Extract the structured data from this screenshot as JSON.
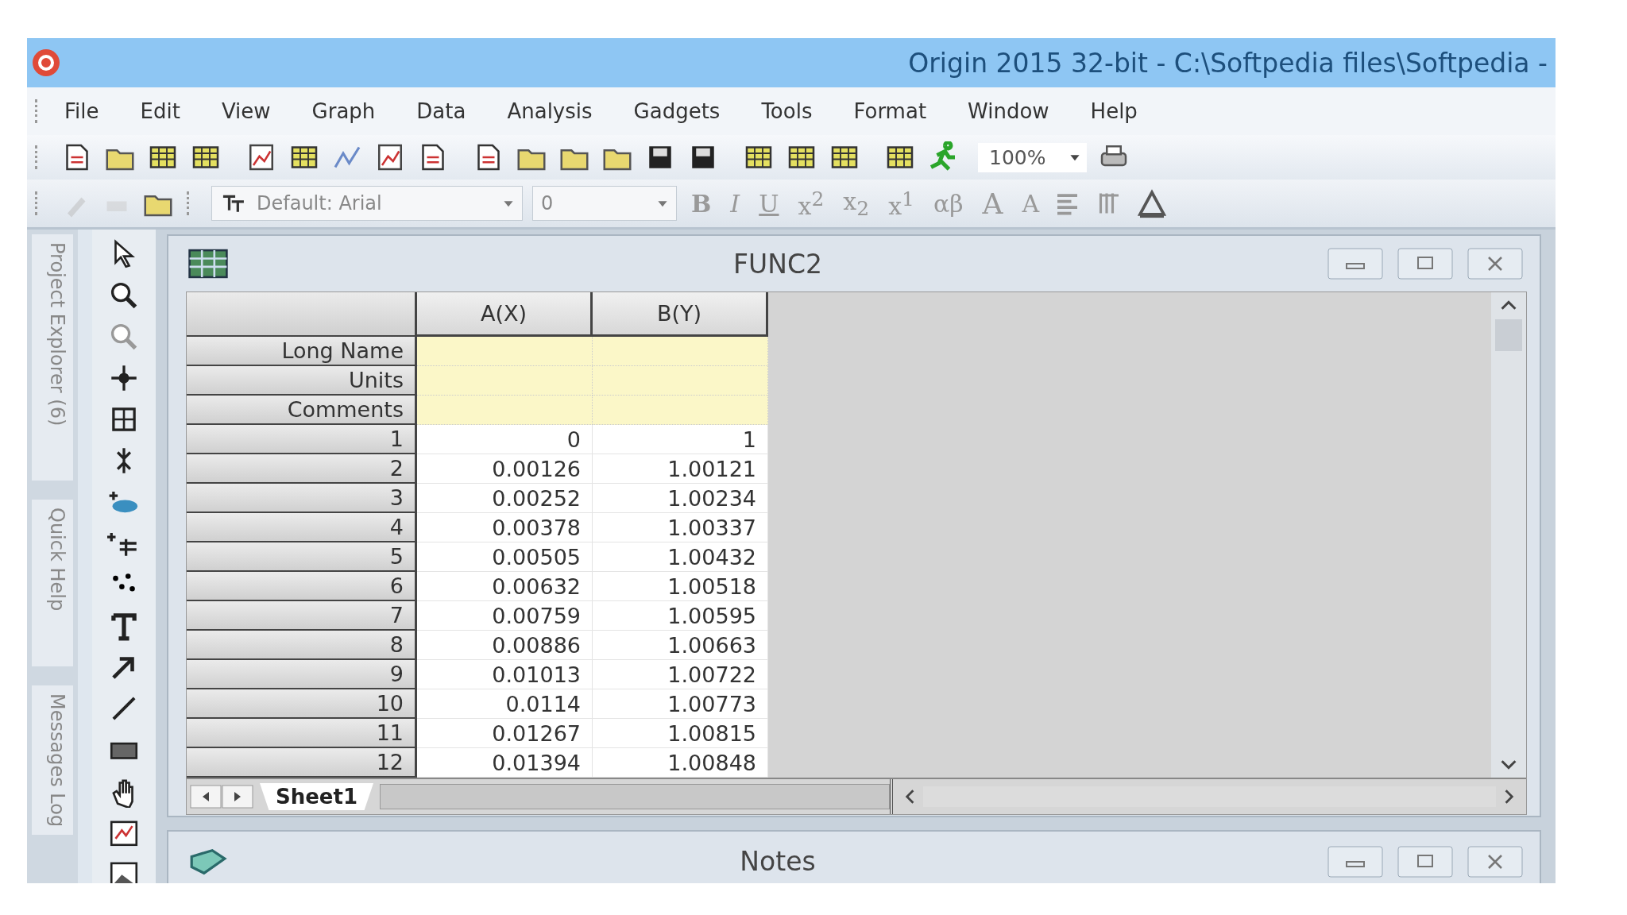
{
  "window": {
    "title": "Origin 2015 32-bit - C:\\Softpedia files\\Softpedia -"
  },
  "menu": [
    "File",
    "Edit",
    "View",
    "Graph",
    "Data",
    "Analysis",
    "Gadgets",
    "Tools",
    "Format",
    "Window",
    "Help"
  ],
  "standard_toolbar": {
    "zoom": "100%"
  },
  "format_toolbar": {
    "font": "Default: Arial",
    "size": "0",
    "buttons": [
      "B",
      "I",
      "U",
      "x$^{2}$",
      "x$_{2}$",
      "x$^{1}$",
      "αβ",
      "A",
      "A"
    ]
  },
  "side_tabs": [
    "Project Explorer (6)",
    "Quick Help",
    "Messages Log"
  ],
  "workbook": {
    "title": "FUNC2",
    "columns": [
      "A(X)",
      "B(Y)"
    ],
    "label_rows": [
      "Long Name",
      "Units",
      "Comments"
    ],
    "rows": [
      {
        "index": "1",
        "cells": [
          "0",
          "1"
        ]
      },
      {
        "index": "2",
        "cells": [
          "0.00126",
          "1.00121"
        ]
      },
      {
        "index": "3",
        "cells": [
          "0.00252",
          "1.00234"
        ]
      },
      {
        "index": "4",
        "cells": [
          "0.00378",
          "1.00337"
        ]
      },
      {
        "index": "5",
        "cells": [
          "0.00505",
          "1.00432"
        ]
      },
      {
        "index": "6",
        "cells": [
          "0.00632",
          "1.00518"
        ]
      },
      {
        "index": "7",
        "cells": [
          "0.00759",
          "1.00595"
        ]
      },
      {
        "index": "8",
        "cells": [
          "0.00886",
          "1.00663"
        ]
      },
      {
        "index": "9",
        "cells": [
          "0.01013",
          "1.00722"
        ]
      },
      {
        "index": "10",
        "cells": [
          "0.0114",
          "1.00773"
        ]
      },
      {
        "index": "11",
        "cells": [
          "0.01267",
          "1.00815"
        ]
      },
      {
        "index": "12",
        "cells": [
          "0.01394",
          "1.00848"
        ]
      }
    ],
    "sheets": [
      "Sheet1"
    ]
  },
  "notes": {
    "title": "Notes"
  }
}
